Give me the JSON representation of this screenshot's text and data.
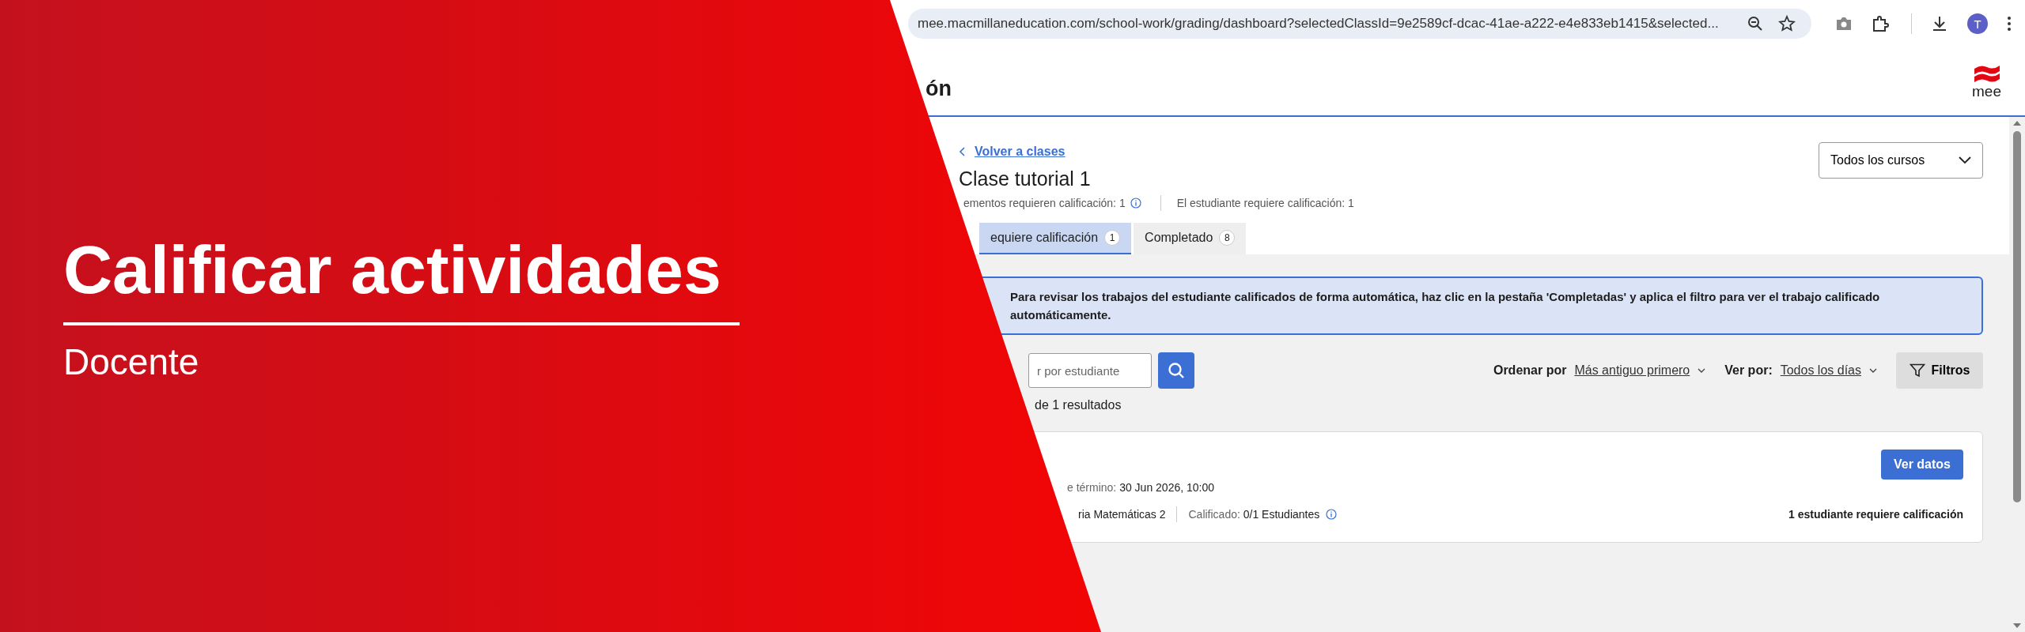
{
  "banner": {
    "title": "Calificar actividades",
    "subtitle": "Docente"
  },
  "browser": {
    "url": "mee.macmillaneducation.com/school-work/grading/dashboard?selectedClassId=9e2589cf-dcac-41ae-a222-e4e833eb1415&selected...",
    "avatar_letter": "T"
  },
  "app_header": {
    "title": "ón",
    "logo_text": "mee"
  },
  "back_link": "Volver a clases",
  "class_title": "Clase tutorial 1",
  "stats": [
    {
      "text": "ementos requieren calificación: 1",
      "info": true
    },
    {
      "text": "El estudiante requiere calificación: 1",
      "info": false
    }
  ],
  "course_select": {
    "value": "Todos los cursos"
  },
  "tabs": [
    {
      "label": "equiere calificación",
      "count": "1",
      "selected": true
    },
    {
      "label": "Completado",
      "count": "8",
      "selected": false
    }
  ],
  "notice": "Para revisar los trabajos del estudiante calificados de forma automática, haz clic en la pestaña 'Completadas' y aplica el filtro para ver el trabajo calificado automáticamente.",
  "search": {
    "placeholder": "r por estudiante"
  },
  "sort": {
    "label": "Ordenar por",
    "value": "Más antiguo primero"
  },
  "view": {
    "label": "Ver por:",
    "value": "Todos los días"
  },
  "filters_button": "Filtros",
  "results": "de 1 resultados",
  "card": {
    "button": "Ver datos",
    "due_label": "e término:",
    "due_value": "30 Jun 2026, 10:00",
    "course": "ria Matemáticas 2",
    "graded_label": "Calificado:",
    "graded_value": "0/1 Estudiantes",
    "status": "1 estudiante requiere calificación"
  }
}
